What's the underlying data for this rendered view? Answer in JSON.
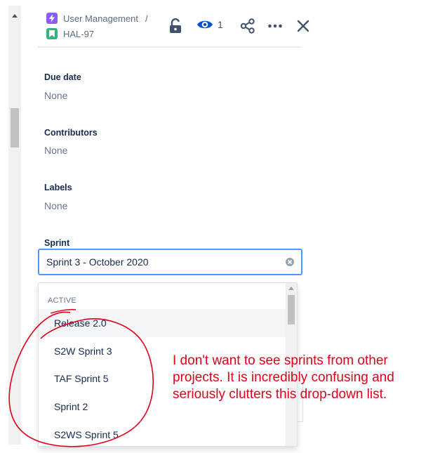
{
  "header": {
    "breadcrumb": [
      {
        "label": "User Management",
        "icon": "lightning-icon",
        "color": "#8b5cf6"
      },
      {
        "label": "HAL-97",
        "icon": "story-bookmark-icon",
        "color": "#36b37e"
      }
    ],
    "separator": "/",
    "watch_count": "1",
    "icons": [
      "unlock-icon",
      "eye-icon",
      "share-icon",
      "more-icon",
      "close-icon"
    ]
  },
  "fields": {
    "due_date": {
      "label": "Due date",
      "value": "None"
    },
    "contributors": {
      "label": "Contributors",
      "value": "None"
    },
    "labels": {
      "label": "Labels",
      "value": "None"
    },
    "sprint": {
      "label": "Sprint",
      "value": "Sprint 3 - October 2020"
    }
  },
  "dropdown": {
    "group_heading": "ACTIVE",
    "options": [
      "Release 2.0",
      "S2W Sprint 3",
      "TAF Sprint 5",
      "Sprint 2",
      "S2WS Sprint 5"
    ],
    "highlighted_index": 0
  },
  "annotation": {
    "text": "I don't want to see sprints from other projects. It is incredibly confusing and seriously clutters this drop-down list.",
    "color": "#e0001b"
  },
  "colors": {
    "focus_border": "#4c9aff",
    "accent": "#0052cc"
  }
}
